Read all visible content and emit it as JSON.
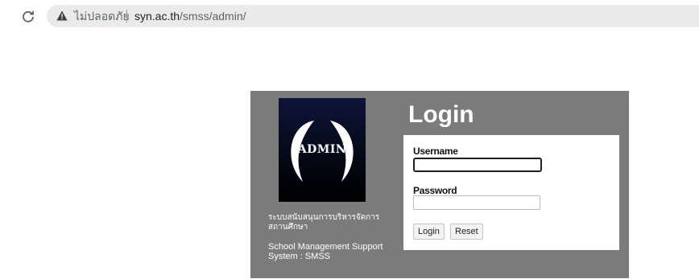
{
  "browser": {
    "security_label": "ไม่ปลอดภัย",
    "url_host": "syn.ac.th",
    "url_path": "/smss/admin/"
  },
  "logo": {
    "text": "ADMIN"
  },
  "system": {
    "thai_name": "ระบบสนับสนุนการบริหารจัดการสถานศึกษา",
    "english_name": "School Management Support System : SMSS"
  },
  "login": {
    "title": "Login",
    "username_label": "Username",
    "username_value": "",
    "password_label": "Password",
    "password_value": "",
    "login_button": "Login",
    "reset_button": "Reset"
  },
  "colors": {
    "panel": "#7b7b7b",
    "logo_bg": "#050814"
  }
}
